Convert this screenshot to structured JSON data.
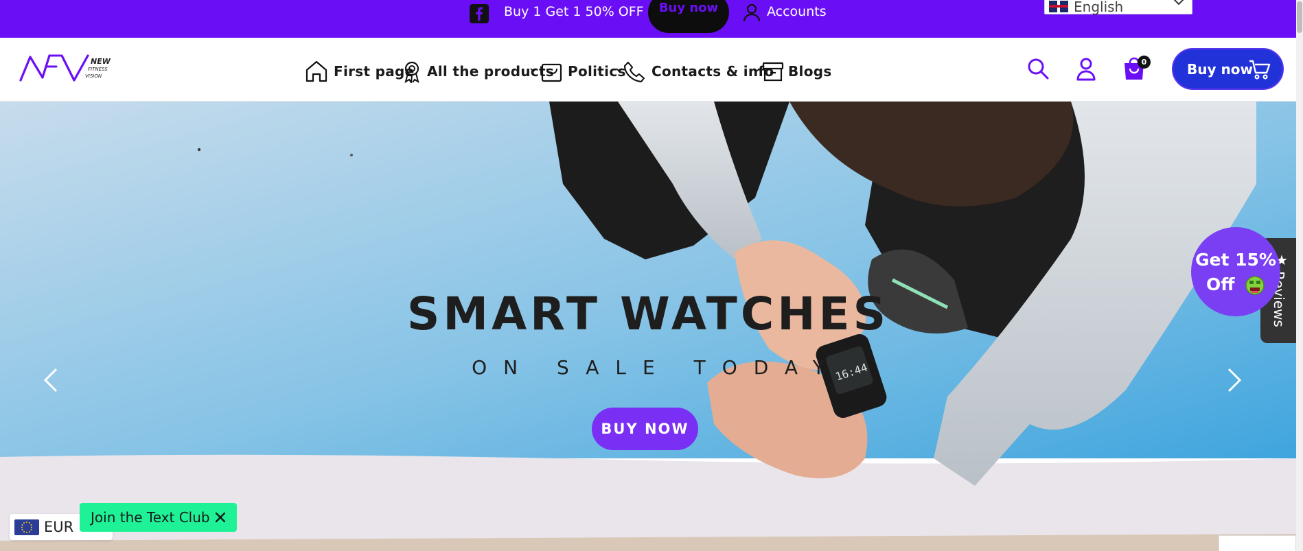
{
  "topbar": {
    "facebook_icon": "facebook-icon",
    "promo_text": "Buy 1 Get 1 50% OFF",
    "buy_now_label": "Buy now",
    "accounts_label": "Accounts",
    "language": "English",
    "background_color": "#6a0ff5"
  },
  "header": {
    "logo_text": [
      "NEW",
      "FITNESS",
      "VISION"
    ],
    "nav": [
      {
        "label": "First page",
        "icon": "home-icon"
      },
      {
        "label": "All the products",
        "icon": "award-badge-icon",
        "dropdown": true
      },
      {
        "label": "Politics",
        "icon": "shopping-bag-icon",
        "dropdown": true
      },
      {
        "label": "Contacts & info",
        "icon": "phone-icon",
        "dropdown": true
      },
      {
        "label": "Blogs",
        "icon": "archive-box-icon"
      }
    ],
    "cart_count": "0",
    "buy_button_label": "Buy now",
    "accent_color": "#6a0ff5",
    "button_color": "#2232d9"
  },
  "hero": {
    "title": "SMART WATCHES",
    "subtitle": "ON SALE TODAY",
    "cta_label": "BUY NOW",
    "cta_color": "#7a2ff5",
    "watch_time": "16:44"
  },
  "widgets": {
    "discount_line1": "Get 15%",
    "discount_line2": "Off",
    "reviews_label": "Reviews",
    "currency": "EUR",
    "text_club_label": "Join the Text Club",
    "text_club_color": "#1ff196"
  }
}
